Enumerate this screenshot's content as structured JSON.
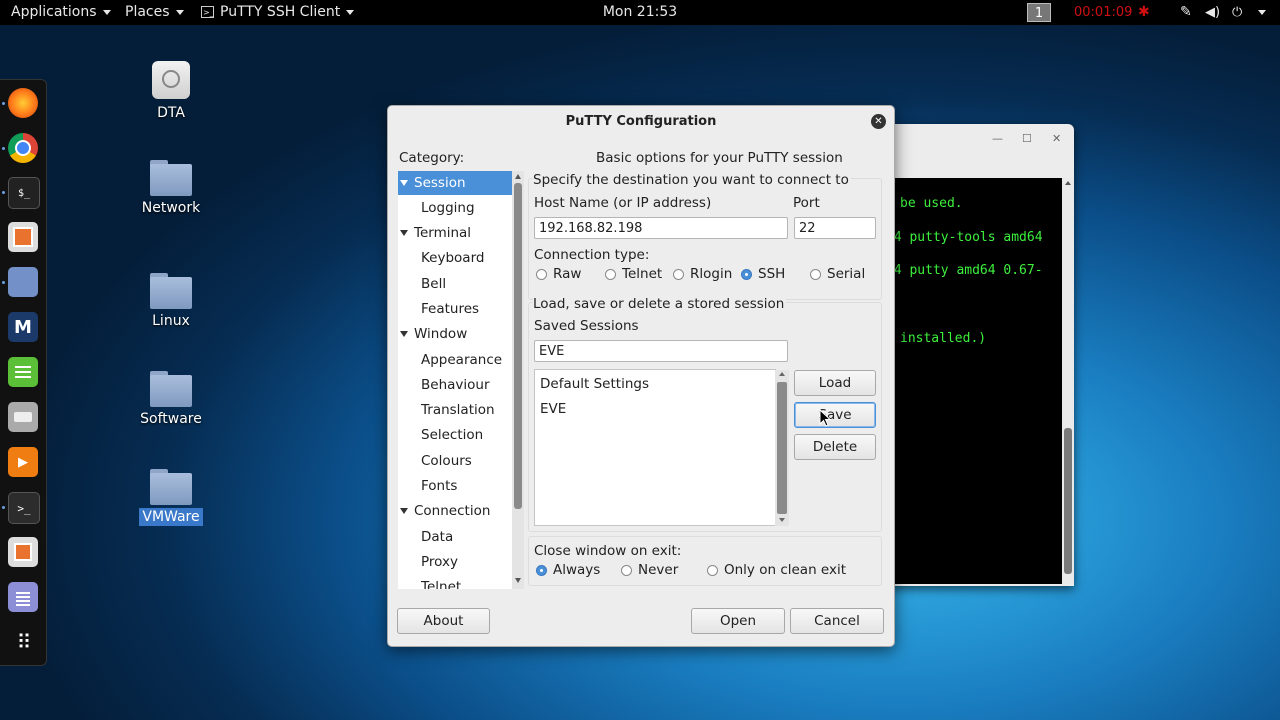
{
  "topbar": {
    "applications": "Applications",
    "places": "Places",
    "app_name": "PuTTY SSH Client",
    "clock": "Mon 21:53",
    "workspace": "1",
    "timer": "00:01:09"
  },
  "desktop": {
    "icons": [
      {
        "label": "DTA"
      },
      {
        "label": "Network"
      },
      {
        "label": "Linux"
      },
      {
        "label": "Software"
      },
      {
        "label": "VMWare"
      }
    ]
  },
  "terminal": {
    "lines": [
      "be used.",
      "64 putty-tools amd64",
      "64 putty amd64 0.67-",
      "installed.)"
    ],
    "text_color": "#3df03d"
  },
  "putty": {
    "title": "PuTTY Configuration",
    "category_label": "Category:",
    "tree": [
      "Session",
      "Logging",
      "Terminal",
      "Keyboard",
      "Bell",
      "Features",
      "Window",
      "Appearance",
      "Behaviour",
      "Translation",
      "Selection",
      "Colours",
      "Fonts",
      "Connection",
      "Data",
      "Proxy",
      "Telnet"
    ],
    "selected_tree_item": "Session",
    "header": "Basic options for your PuTTY session",
    "destination_label": "Specify the destination you want to connect to",
    "host_label": "Host Name (or IP address)",
    "host_value": "192.168.82.198",
    "port_label": "Port",
    "port_value": "22",
    "conn_type_label": "Connection type:",
    "conn_types": [
      "Raw",
      "Telnet",
      "Rlogin",
      "SSH",
      "Serial"
    ],
    "conn_type_selected": "SSH",
    "load_save_label": "Load, save or delete a stored session",
    "saved_sessions_label": "Saved Sessions",
    "saved_session_value": "EVE",
    "sessions": [
      "Default Settings",
      "EVE"
    ],
    "load_button": "Load",
    "save_button": "Save",
    "delete_button": "Delete",
    "close_label": "Close window on exit:",
    "close_options": [
      "Always",
      "Never",
      "Only on clean exit"
    ],
    "close_selected": "Always",
    "about_button": "About",
    "open_button": "Open",
    "cancel_button": "Cancel",
    "accent_color": "#4a90d9"
  }
}
